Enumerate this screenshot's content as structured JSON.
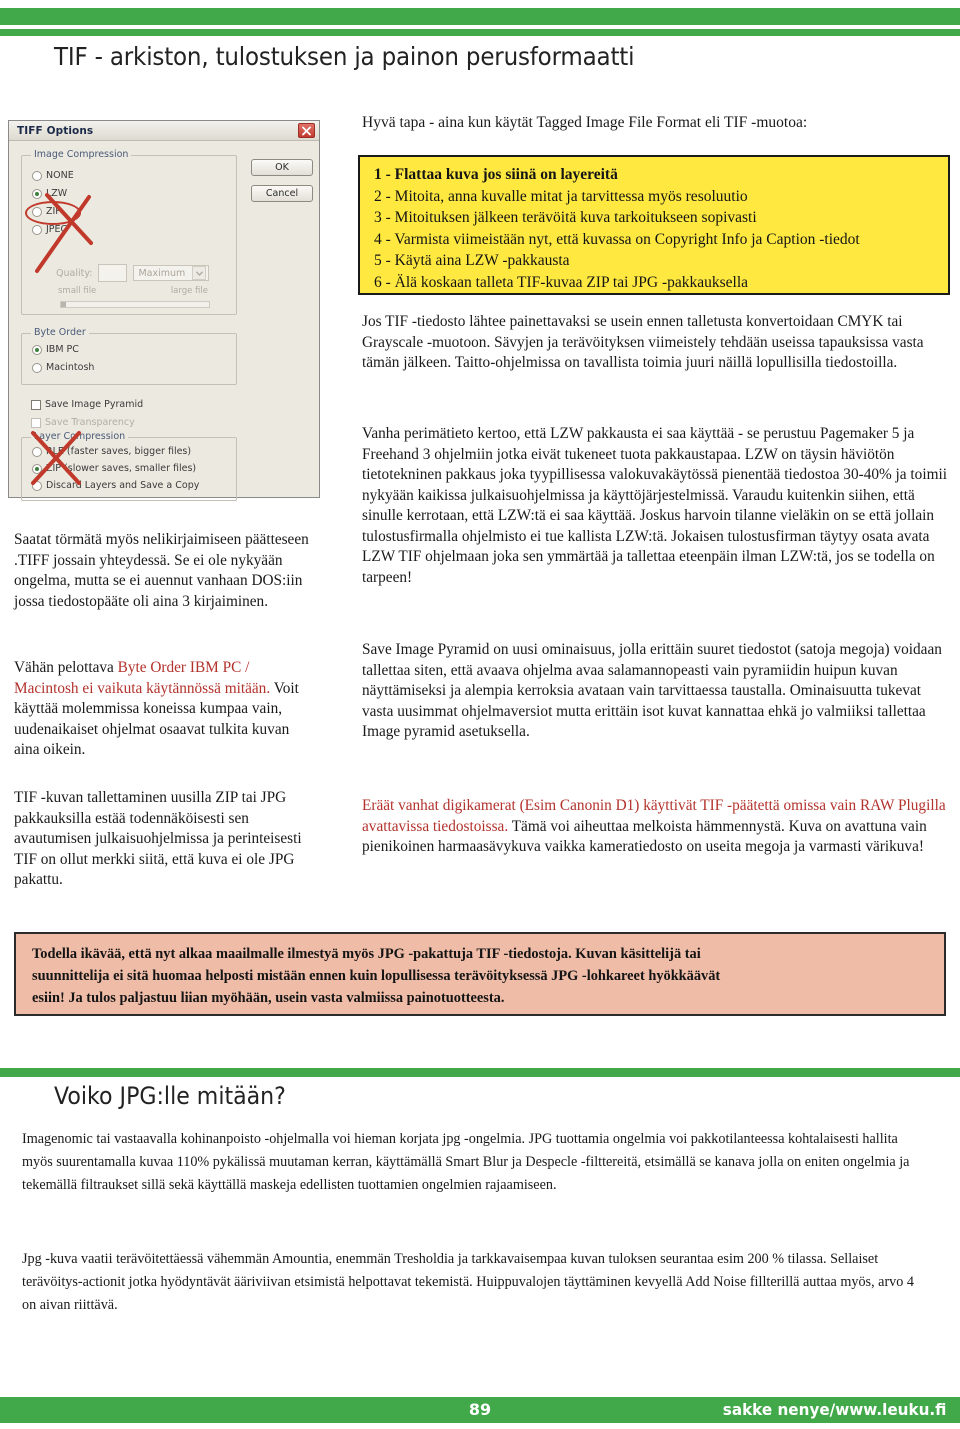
{
  "header": {
    "title": "TIF - arkiston, tulostuksen ja painon perusformaatti",
    "accent_green": "#42a94a"
  },
  "dialog": {
    "title": "TIFF Options",
    "close_icon": "close-icon",
    "buttons": {
      "ok": "OK",
      "cancel": "Cancel"
    },
    "image_compression": {
      "legend": "Image Compression",
      "options": [
        "NONE",
        "LZW",
        "ZIP",
        "JPEG"
      ],
      "selected": "LZW",
      "quality_label": "Quality:",
      "quality_value": "",
      "quality_preset": "Maximum",
      "slider_min_label": "small file",
      "slider_max_label": "large file"
    },
    "byte_order": {
      "legend": "Byte Order",
      "options": [
        "IBM PC",
        "Macintosh"
      ],
      "selected": "IBM PC"
    },
    "checkboxes": [
      {
        "label": "Save Image Pyramid",
        "checked": false,
        "disabled": false
      },
      {
        "label": "Save Transparency",
        "checked": false,
        "disabled": true
      }
    ],
    "layer_compression": {
      "legend": "Layer Compression",
      "options": [
        "RLE (faster saves, bigger files)",
        "ZIP (slower saves, smaller files)",
        "Discard Layers and Save a Copy"
      ],
      "selected": "ZIP (slower saves, smaller files)"
    },
    "annotations": {
      "circle_on": "LZW",
      "cross_over": [
        "ZIP/JPEG",
        "Layer Compression"
      ],
      "color": "#c0392b"
    }
  },
  "intro_line": "Hyvä tapa - aina kun käytät Tagged Image File Format eli TIF -muotoa:",
  "yellow_box": {
    "background": "#ffe940",
    "lines": [
      "1 - Flattaa kuva jos siinä on layereitä",
      "2 - Mitoita, anna kuvalle mitat ja tarvittessa myös resoluutio",
      "3 - Mitoituksen jälkeen terävöitä kuva tarkoitukseen sopivasti",
      "4 - Varmista viimeistään nyt,  että kuvassa on Copyright Info ja Caption -tiedot",
      "5 - Käytä aina LZW -pakkausta",
      "6 - Älä koskaan talleta TIF-kuvaa ZIP tai JPG -pakkauksella"
    ],
    "bold_line_index": 0
  },
  "right_column": {
    "para1": "Jos TIF -tiedosto lähtee painettavaksi se usein ennen talletusta konvertoidaan CMYK tai Grayscale -muotoon. Sävyjen ja terävöityksen viimeistely tehdään useissa tapauksissa vasta tämän jälkeen. Taitto-ohjelmissa on tavallista toimia juuri näillä lopullisilla tiedostoilla.",
    "para2": "Vanha perimätieto kertoo, että LZW pakkausta ei saa käyttää - se perustuu Pagemaker 5 ja Freehand 3 ohjelmiin jotka eivät tukeneet tuota pakkaustapaa. LZW on täysin häviötön tietotekninen pakkaus joka tyypillisessa valokuvakäytössä pienentää tiedostoa 30-40% ja toimii nykyään kaikissa julkaisuohjelmissa ja käyttöjärjestelmissä. Varaudu kuitenkin siihen, että sinulle kerrotaan, että LZW:tä ei saa käyttää. Joskus harvoin tilanne vieläkin on se että jollain tulostusfirmalla ohjelmisto ei tue kallista LZW:tä. Jokaisen tulostusfirman täytyy osata avata LZW TIF ohjelmaan joka sen ymmärtää ja tallettaa eteenpäin ilman LZW:tä, jos se todella on tarpeen!",
    "para3": "Save Image Pyramid on uusi ominaisuus, jolla erittäin suuret tiedostot (satoja megoja) voidaan tallettaa siten, että avaava ohjelma avaa salamannopeasti vain pyramiidin huipun kuvan näyttämiseksi ja alempia kerroksia avataan vain tarvittaessa taustalla. Ominaisuutta tukevat vasta uusimmat ohjelmaversiot mutta erittäin isot kuvat kannattaa ehkä jo valmiiksi tallettaa Image pyramid asetuksella.",
    "para4_red": "Eräät vanhat digikamerat (Esim Canonin  D1) käyttivät TIF -päätettä omissa vain RAW Plugilla avattavissa tiedostoissa.",
    "para4_rest": " Tämä voi aiheuttaa melkoista hämmennystä. Kuva on avattuna vain pienikoinen harmaasävykuva vaikka kameratiedosto on useita megoja ja varmasti värikuva!"
  },
  "left_column": {
    "para1": "Saatat törmätä myös nelikirjaimiseen päätteseen .TIFF jossain yhteydessä. Se ei ole nykyään ongelma, mutta se ei auennut vanhaan DOS:iin jossa tiedostopääte oli aina 3 kirjaiminen.",
    "para2_lead": "Vähän pelottava ",
    "para2_red": "Byte Order IBM PC / Macintosh ei vaikuta käytännössä mitään.",
    "para2_rest": " Voit käyttää molemmissa koneissa kumpaa vain, uudenaikaiset ohjelmat osaavat tulkita kuvan aina oikein.",
    "para3": "TIF -kuvan tallettaminen uusilla ZIP tai JPG pakkauksilla estää todennäköisesti sen avautumisen julkaisuohjelmissa ja perinteisesti TIF on ollut merkki siitä, että kuva ei ole JPG pakattu."
  },
  "callout": {
    "background": "#efbca8",
    "lines": [
      "Todella ikävää, että nyt alkaa maailmalle ilmestyä myös JPG -pakattuja TIF -tiedostoja. Kuvan käsittelijä tai",
      "suunnittelija ei sitä huomaa helposti mistään ennen kuin lopullisessa terävöityksessä JPG -lohkareet hyökkäävät",
      "esiin! Ja tulos paljastuu liian myöhään, usein vasta valmiissa painotuotteesta."
    ]
  },
  "section2": {
    "title": "Voiko JPG:lle mitään?",
    "para1": "Imagenomic tai vastaavalla  kohinanpoisto -ohjelmalla voi hieman korjata jpg -ongelmia. JPG tuottamia ongelmia voi pakkotilanteessa kohtalaisesti hallita myös suurentamalla kuvaa 110% pykälissä muutaman kerran, käyttämällä Smart Blur ja Despecle -filttereitä, etsimällä se kanava jolla on eniten ongelmia ja tekemällä  filtraukset sillä sekä käyttällä maskeja edellisten tuottamien ongelmien rajaamiseen.",
    "para2": "Jpg -kuva vaatii terävöitettäessä vähemmän Amountia, enemmän Tresholdia ja  tarkkavaisempaa kuvan tuloksen seurantaa esim 200 % tilassa. Sellaiset terävöitys-actionit jotka hyödyntävät ääriviivan etsimistä helpottavat tekemistä. Huippuvalojen täyttäminen kevyellä Add Noise fillterillä auttaa myös, arvo 4 on aivan riittävä."
  },
  "footer": {
    "page_number": "89",
    "credit": "sakke nenye/www.leuku.fi"
  }
}
